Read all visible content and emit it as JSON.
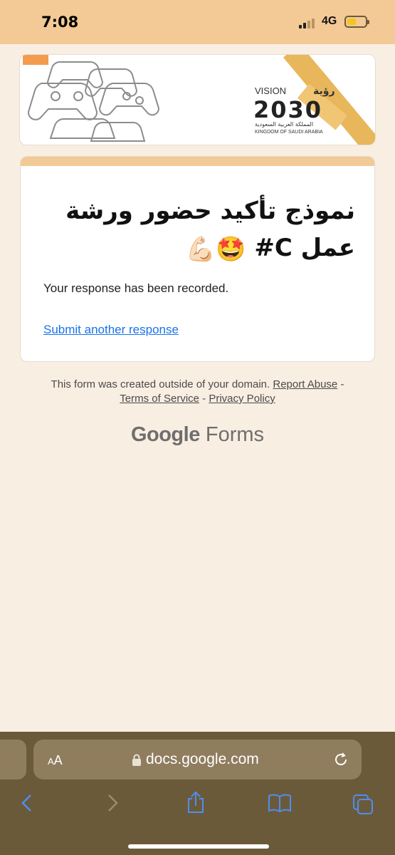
{
  "status_bar": {
    "time": "7:08",
    "network": "4G",
    "battery_level": 0.45,
    "battery_color": "#f2c520"
  },
  "banner": {
    "vision_text": "VISION",
    "vision_arabic": "رؤية",
    "year": "2030",
    "kingdom_arabic": "المملكة العربية السعودية",
    "kingdom_english": "KINGDOM OF SAUDI ARABIA"
  },
  "form": {
    "title_text": "نموذج تأكيد حضور ورشة عمل C#",
    "title_emoji": "🤩💪🏻",
    "confirmation": "Your response has been recorded.",
    "submit_another": "Submit another response",
    "accent_color": "#f3c995"
  },
  "footer": {
    "domain_notice": "This form was created outside of your domain.",
    "report_abuse": "Report Abuse",
    "terms": "Terms of Service",
    "privacy": "Privacy Policy",
    "separator": "-",
    "brand_google": "Google",
    "brand_forms": "Forms"
  },
  "browser": {
    "text_size_label": "AA",
    "url": "docs.google.com",
    "icons": [
      "back-icon",
      "forward-icon",
      "share-icon",
      "bookmarks-icon",
      "tabs-icon",
      "lock-icon",
      "reload-icon"
    ]
  }
}
